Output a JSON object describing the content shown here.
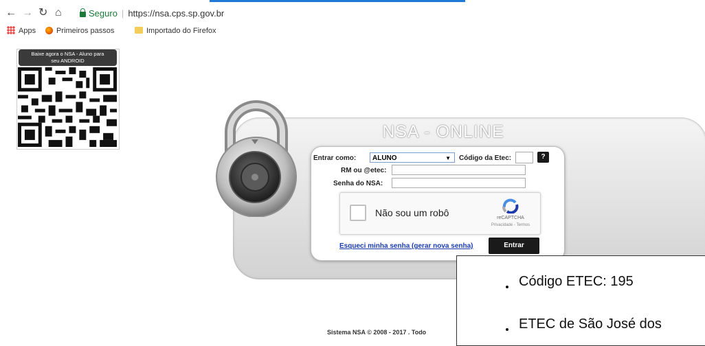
{
  "browser": {
    "secure_label": "Seguro",
    "url": "https://nsa.cps.sp.gov.br"
  },
  "bookmarks": {
    "items": [
      {
        "label": "Apps",
        "icon": "apps-grid-icon"
      },
      {
        "label": "Primeiros passos",
        "icon": "firefox-icon"
      },
      {
        "label": "Importado do Firefox",
        "icon": "folder-icon"
      }
    ]
  },
  "qr": {
    "label_line1": "Baixe agora o NSA - Aluno para",
    "label_line2": "seu ANDROID"
  },
  "login": {
    "title": "NSA - ONLINE",
    "entrar_como_label": "Entrar como:",
    "entrar_como_value": "ALUNO",
    "codigo_label": "Código da Etec:",
    "help_label": "?",
    "rm_label": "RM ou @etec:",
    "senha_label": "Senha do NSA:",
    "captcha_text": "Não sou um robô",
    "captcha_brand": "reCAPTCHA",
    "captcha_terms": "Privacidade - Termos",
    "forgot_link": "Esqueci minha senha (gerar nova senha)",
    "enter_button": "Entrar"
  },
  "footer": {
    "text": "Sistema NSA    © 2008 - 2017 .  Todo"
  },
  "overlay": {
    "bullets": [
      "Código ETEC: 195",
      "ETEC de São José dos"
    ]
  }
}
